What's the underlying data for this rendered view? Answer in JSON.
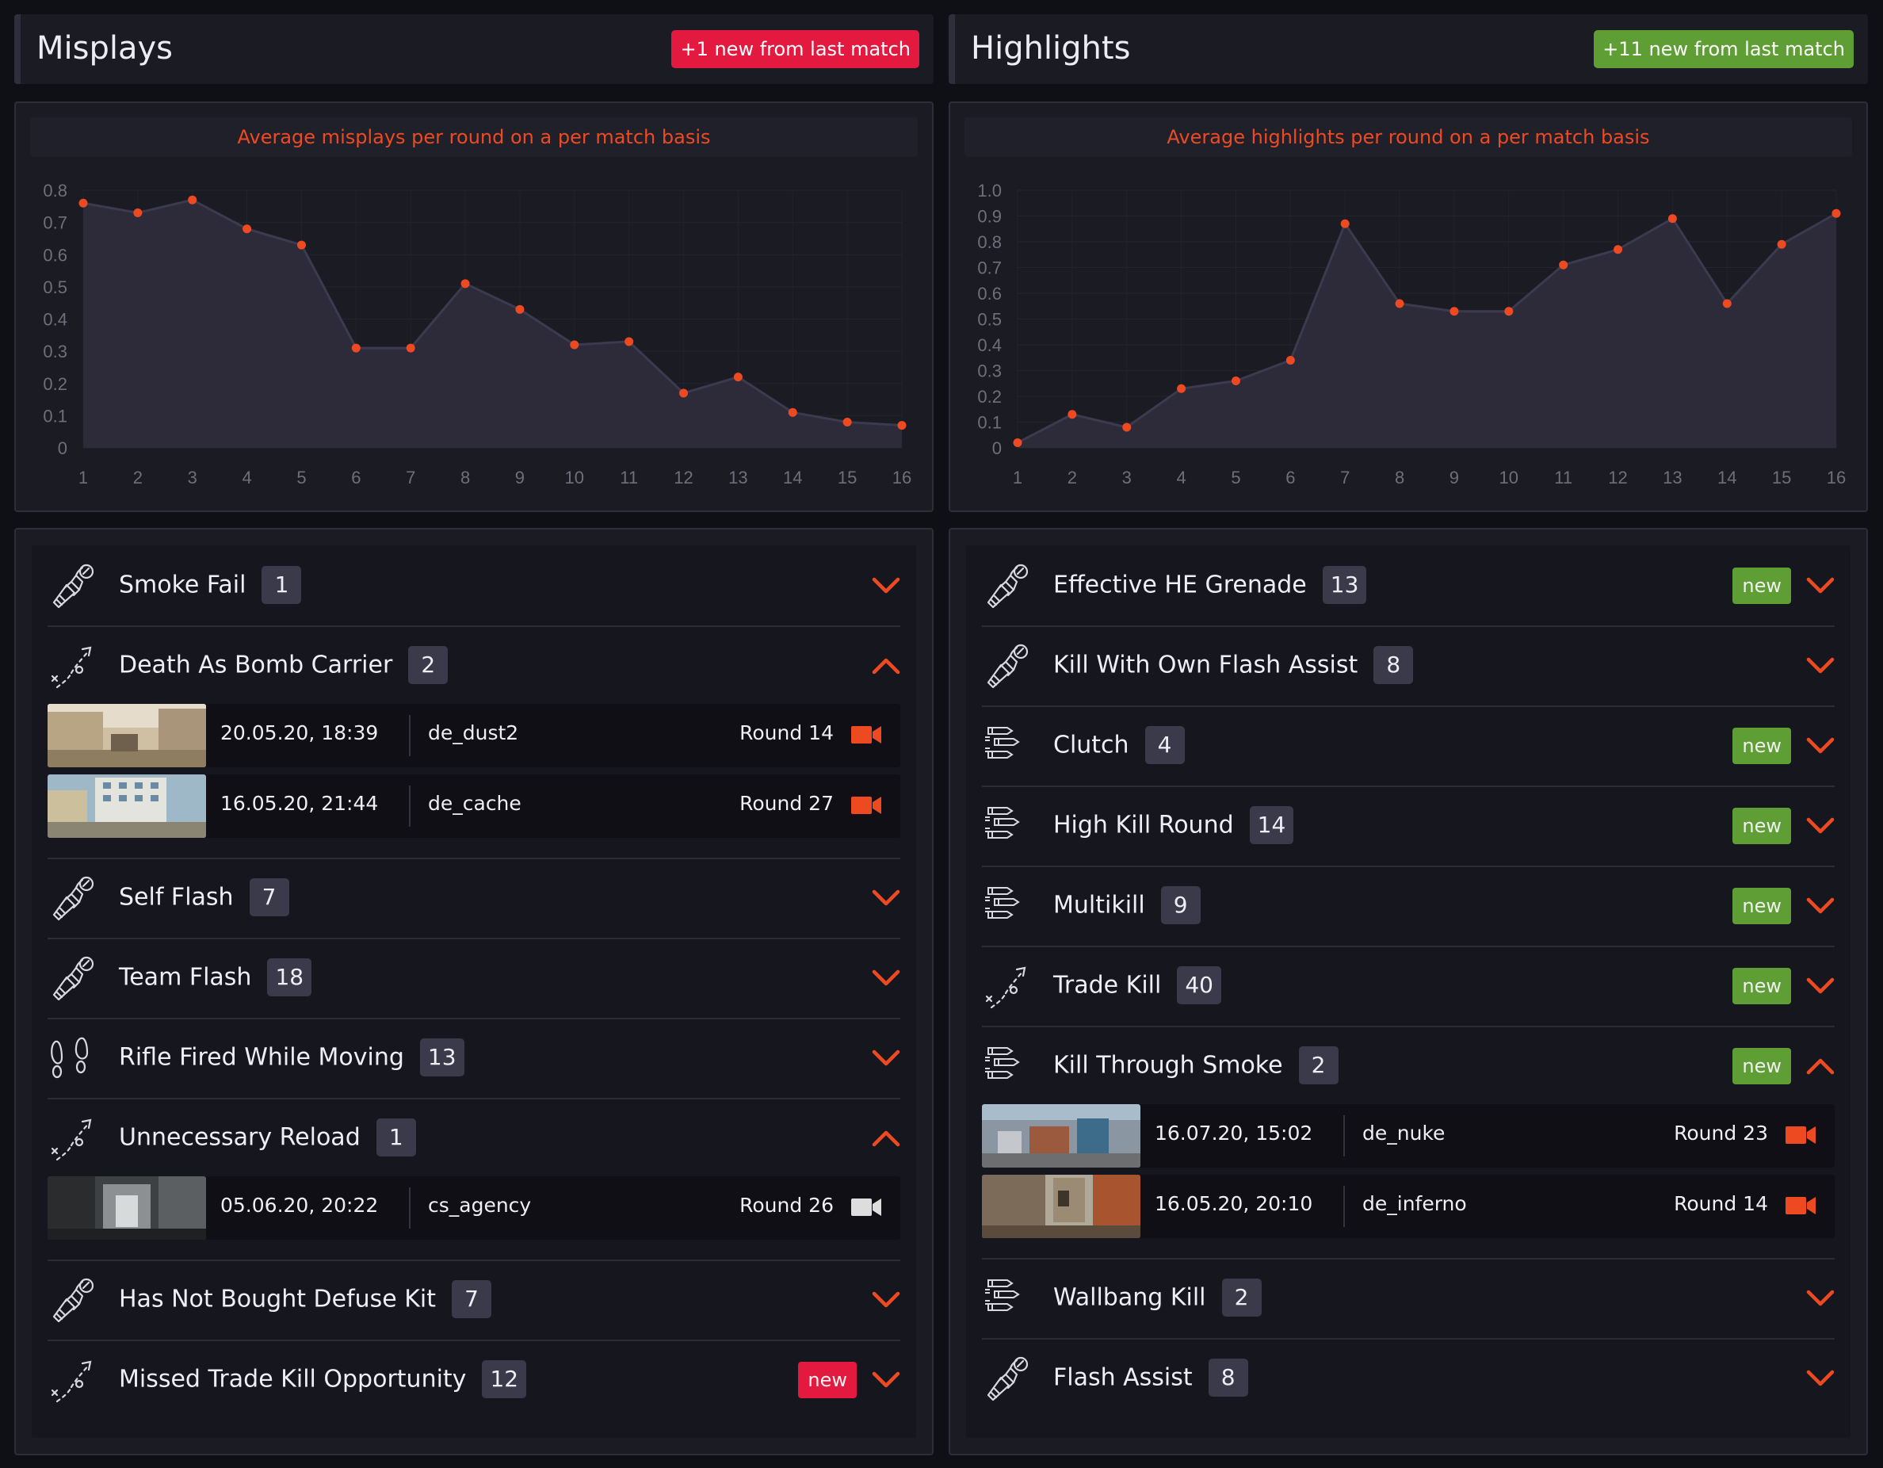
{
  "misplays": {
    "title": "Misplays",
    "badge": "+1 new from last match",
    "chart_title": "Average misplays per round on a per match basis",
    "chart_data": {
      "type": "area",
      "title": "Average misplays per round on a per match basis",
      "x": [
        1,
        2,
        3,
        4,
        5,
        6,
        7,
        8,
        9,
        10,
        11,
        12,
        13,
        14,
        15,
        16
      ],
      "values": [
        0.76,
        0.73,
        0.77,
        0.68,
        0.63,
        0.31,
        0.31,
        0.51,
        0.43,
        0.32,
        0.33,
        0.17,
        0.22,
        0.11,
        0.08,
        0.07
      ],
      "yticks": [
        "0",
        "0.1",
        "0.2",
        "0.3",
        "0.4",
        "0.5",
        "0.6",
        "0.7",
        "0.8"
      ],
      "ylim": [
        0,
        0.8
      ],
      "grid": true
    },
    "items": [
      {
        "icon": "grenade-icon",
        "label": "Smoke Fail",
        "count": "1",
        "new": "",
        "expanded": false
      },
      {
        "icon": "route-icon",
        "label": "Death As Bomb Carrier",
        "count": "2",
        "new": "",
        "expanded": true,
        "events": [
          {
            "thumb": "dust",
            "date": "20.05.20, 18:39",
            "map": "de_dust2",
            "round": "Round 14",
            "video": "available"
          },
          {
            "thumb": "cache",
            "date": "16.05.20, 21:44",
            "map": "de_cache",
            "round": "Round 27",
            "video": "available"
          }
        ]
      },
      {
        "icon": "grenade-icon",
        "label": "Self Flash",
        "count": "7",
        "new": "",
        "expanded": false
      },
      {
        "icon": "grenade-icon",
        "label": "Team Flash",
        "count": "18",
        "new": "",
        "expanded": false
      },
      {
        "icon": "footsteps-icon",
        "label": "Rifle Fired While Moving",
        "count": "13",
        "new": "",
        "expanded": false
      },
      {
        "icon": "route-icon",
        "label": "Unnecessary Reload",
        "count": "1",
        "new": "",
        "expanded": true,
        "events": [
          {
            "thumb": "agency",
            "date": "05.06.20, 20:22",
            "map": "cs_agency",
            "round": "Round 26",
            "video": "unavailable"
          }
        ]
      },
      {
        "icon": "grenade-icon",
        "label": "Has Not Bought Defuse Kit",
        "count": "7",
        "new": "",
        "expanded": false
      },
      {
        "icon": "route-icon",
        "label": "Missed Trade Kill Opportunity",
        "count": "12",
        "new": "new",
        "expanded": false
      }
    ]
  },
  "highlights": {
    "title": "Highlights",
    "badge": "+11 new from last match",
    "chart_title": "Average highlights per round on a per match basis",
    "chart_data": {
      "type": "area",
      "title": "Average highlights per round on a per match basis",
      "x": [
        1,
        2,
        3,
        4,
        5,
        6,
        7,
        8,
        9,
        10,
        11,
        12,
        13,
        14,
        15,
        16
      ],
      "values": [
        0.02,
        0.13,
        0.08,
        0.23,
        0.26,
        0.34,
        0.87,
        0.56,
        0.53,
        0.53,
        0.71,
        0.77,
        0.89,
        0.56,
        0.79,
        0.91
      ],
      "yticks": [
        "0",
        "0.1",
        "0.2",
        "0.3",
        "0.4",
        "0.5",
        "0.6",
        "0.7",
        "0.8",
        "0.9",
        "1.0"
      ],
      "ylim": [
        0,
        1.0
      ],
      "grid": true
    },
    "items": [
      {
        "icon": "grenade-icon",
        "label": "Effective HE Grenade",
        "count": "13",
        "new": "new",
        "expanded": false
      },
      {
        "icon": "grenade-icon",
        "label": "Kill With Own Flash Assist",
        "count": "8",
        "new": "",
        "expanded": false
      },
      {
        "icon": "bullets-icon",
        "label": "Clutch",
        "count": "4",
        "new": "new",
        "expanded": false
      },
      {
        "icon": "bullets-icon",
        "label": "High Kill Round",
        "count": "14",
        "new": "new",
        "expanded": false
      },
      {
        "icon": "bullets-icon",
        "label": "Multikill",
        "count": "9",
        "new": "new",
        "expanded": false
      },
      {
        "icon": "route-icon",
        "label": "Trade Kill",
        "count": "40",
        "new": "new",
        "expanded": false
      },
      {
        "icon": "bullets-icon",
        "label": "Kill Through Smoke",
        "count": "2",
        "new": "new",
        "expanded": true,
        "events": [
          {
            "thumb": "nuke",
            "date": "16.07.20, 15:02",
            "map": "de_nuke",
            "round": "Round 23",
            "video": "available"
          },
          {
            "thumb": "inferno",
            "date": "16.05.20, 20:10",
            "map": "de_inferno",
            "round": "Round 14",
            "video": "available"
          }
        ]
      },
      {
        "icon": "bullets-icon",
        "label": "Wallbang Kill",
        "count": "2",
        "new": "",
        "expanded": false
      },
      {
        "icon": "grenade-icon",
        "label": "Flash Assist",
        "count": "8",
        "new": "",
        "expanded": false
      }
    ]
  },
  "colors": {
    "accent": "#ee4a22",
    "new_green": "#5e9e34",
    "new_red": "#e3193f",
    "video_unavailable": "#dddddd"
  }
}
